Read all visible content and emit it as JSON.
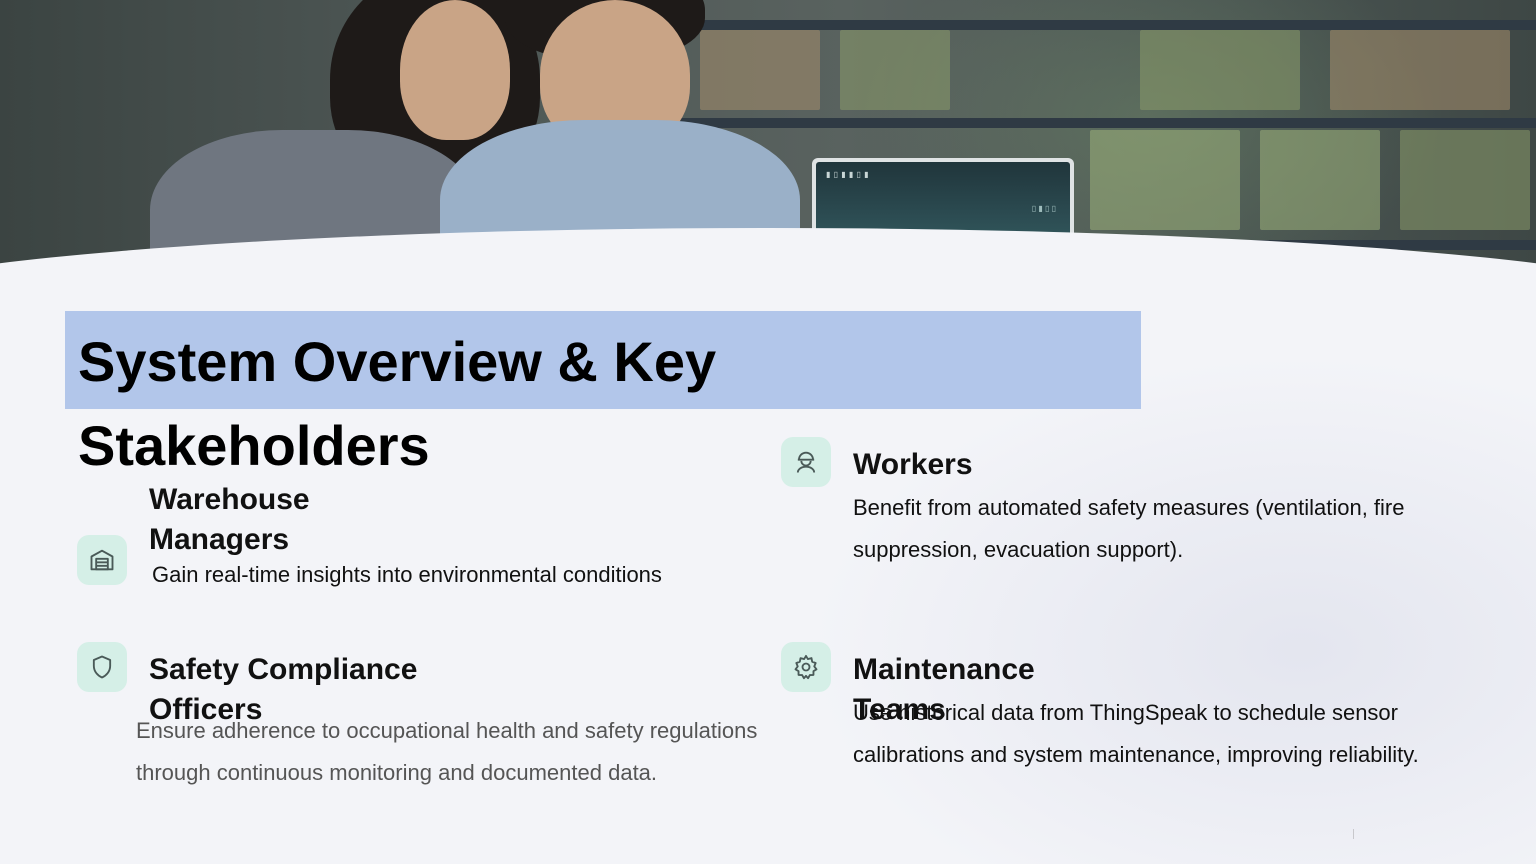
{
  "slide": {
    "title": "System Overview & Key Stakeholders"
  },
  "stakeholders": [
    {
      "icon": "warehouse-icon",
      "title": "Warehouse Managers",
      "description": "Gain real-time insights into environmental conditions"
    },
    {
      "icon": "worker-helmet-icon",
      "title": "Workers",
      "description": "Benefit from automated safety measures (ventilation, fire suppression, evacuation support)."
    },
    {
      "icon": "shield-icon",
      "title": "Safety Compliance Officers",
      "description": "Ensure adherence to occupational health and safety regulations through continuous monitoring and documented data."
    },
    {
      "icon": "gear-icon",
      "title": "Maintenance Teams",
      "description": "Use historical data from ThingSpeak to schedule sensor calibrations and system maintenance, improving reliability."
    }
  ],
  "colors": {
    "title_band": "#b2c6ea",
    "icon_badge": "#d5efe7",
    "icon_stroke": "#4a5a58",
    "background": "#f3f4f8"
  }
}
